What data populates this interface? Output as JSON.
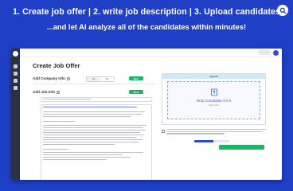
{
  "headline": "1. Create job offer  | 2. write job description | 3. Upload candidates",
  "subline": "...and let AI analyze all of the candidates within minutes!",
  "app": {
    "page_title": "Create Job Offer",
    "company_info_label": "Add Company Info",
    "job_info_label": "Add Job Info",
    "toggle_options": [
      "Yes",
      "No"
    ],
    "save_label": "Save",
    "upload_panel": {
      "header": "Uploads",
      "drop_text": "Drop Candidate CV-s",
      "sub_text": "Select Files"
    },
    "accent_green": "#18b66a",
    "accent_blue": "#2d49d0",
    "progress_fraction": 0.55
  },
  "icons": {
    "search": "search-icon",
    "upload": "upload-icon",
    "info": "info-icon"
  }
}
